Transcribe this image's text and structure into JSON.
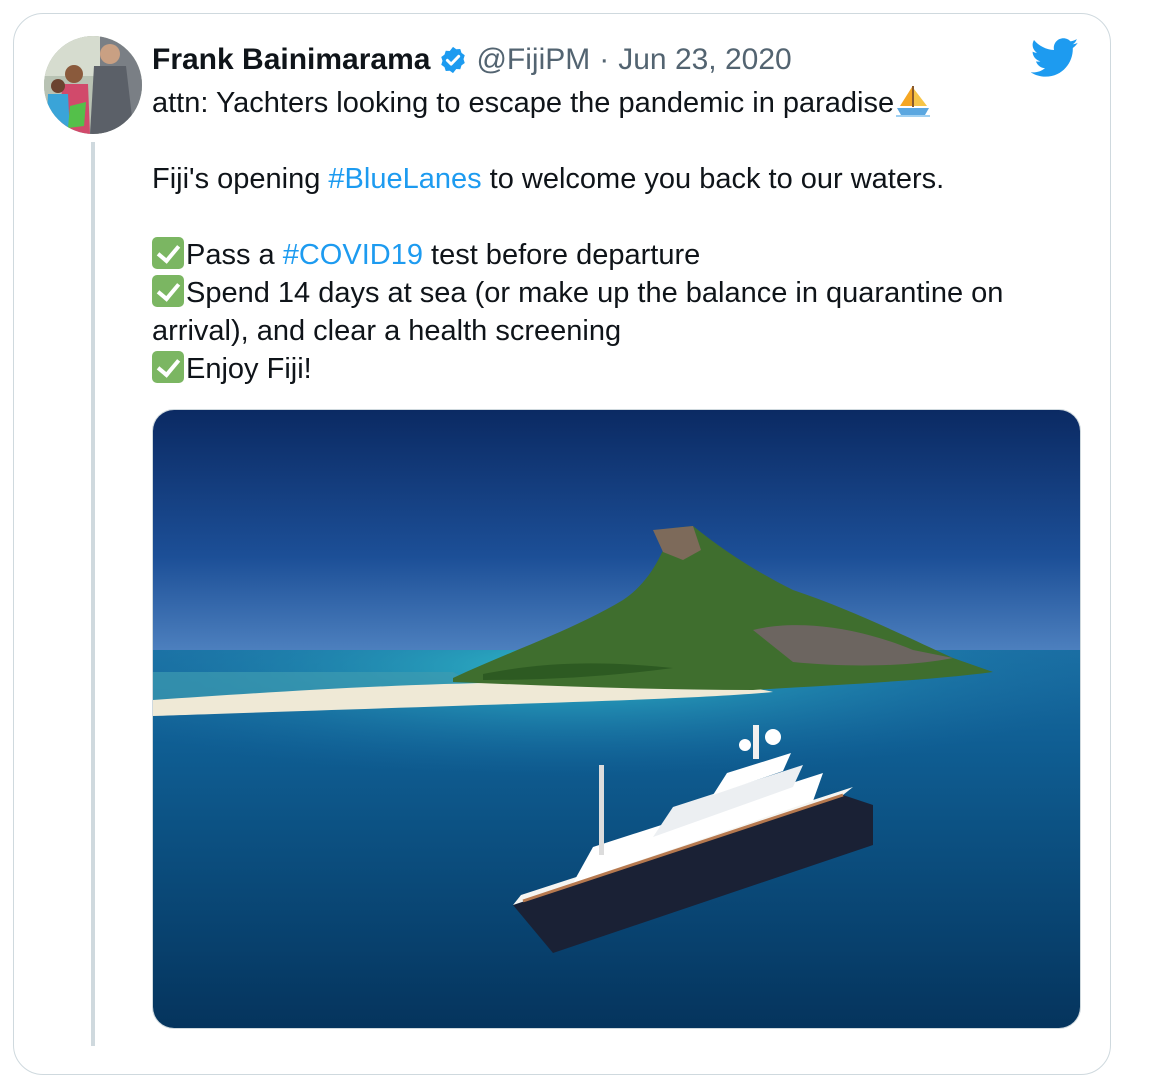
{
  "tweet": {
    "author_name": "Frank Bainimarama",
    "handle": "@FijiPM",
    "separator": "·",
    "date": "Jun 23, 2020",
    "line1": "attn: Yachters looking to escape the pandemic in paradise",
    "line2_before": "Fiji's opening ",
    "line2_hashtag": "#BlueLanes",
    "line2_after": " to welcome you back to our waters.",
    "check1_before": "Pass a ",
    "check1_hashtag": "#COVID19",
    "check1_after": " test before departure",
    "check2": "Spend 14 days at sea (or make up the balance in quarantine on arrival), and clear a health screening",
    "check3": "Enjoy Fiji!"
  },
  "icons": {
    "verified": "verified-badge-icon",
    "brand": "twitter-bird-icon",
    "sailboat": "sailboat-emoji-icon",
    "check": "check-mark-emoji-icon"
  },
  "colors": {
    "link": "#1d9bf0",
    "brand": "#1d9bf0",
    "text": "#0f1419",
    "muted": "#536471",
    "check": "#7bb662"
  }
}
